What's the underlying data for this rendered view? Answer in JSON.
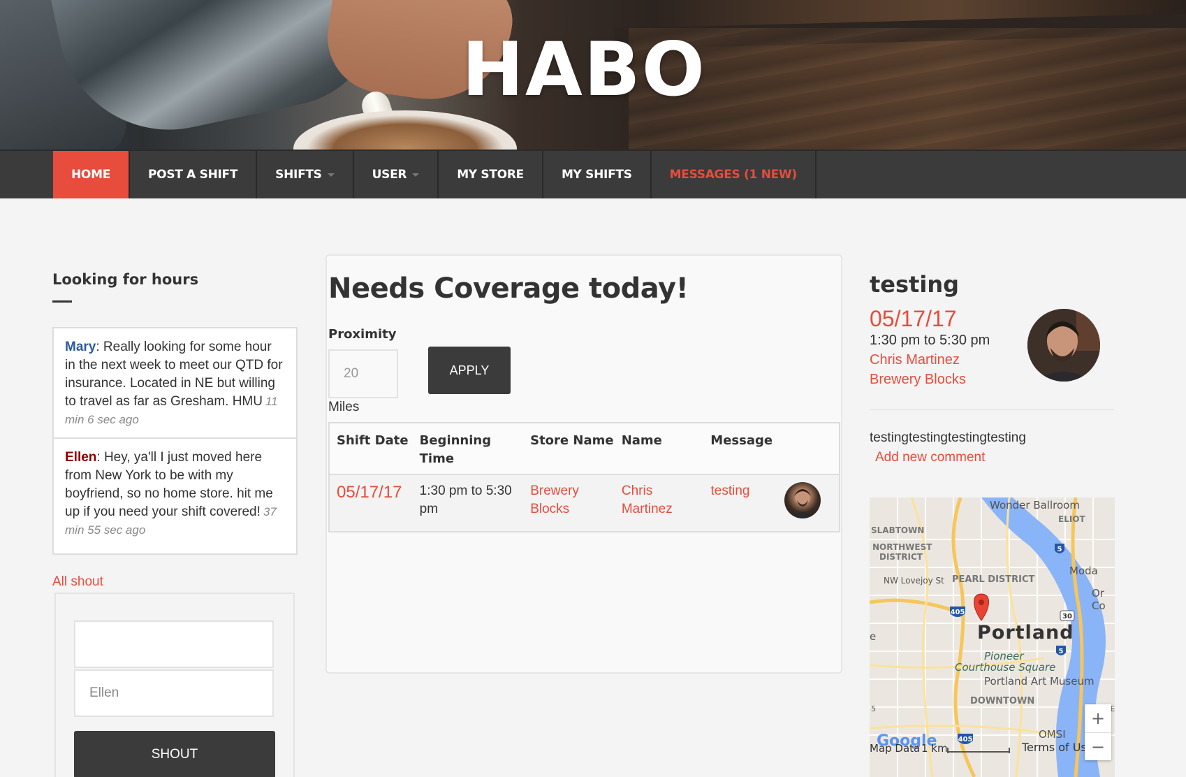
{
  "hero": {
    "title": "HABO"
  },
  "nav": {
    "items": [
      {
        "label": "HOME"
      },
      {
        "label": "POST A SHIFT"
      },
      {
        "label": "SHIFTS"
      },
      {
        "label": "USER"
      },
      {
        "label": "MY STORE"
      },
      {
        "label": "MY SHIFTS"
      },
      {
        "label": "MESSAGES (1 NEW)"
      }
    ]
  },
  "left": {
    "title": "Looking for hours",
    "shouts": [
      {
        "user": "Mary",
        "text": ": Really looking for some hour in the next week to meet our QTD for insurance. Located in NE but willing to travel as far as Gresham. HMU",
        "ago": "11 min 6 sec ago"
      },
      {
        "user": "Ellen",
        "text": ": Hey, ya'll I just moved here from New York to be with my boyfriend, so no home store. hit me up if you need your shift covered!",
        "ago": "37 min 55 sec ago"
      }
    ],
    "all_shout": "All shout",
    "form": {
      "name_value": "Ellen",
      "button": "SHOUT"
    }
  },
  "center": {
    "title": "Needs Coverage today!",
    "proximity_label": "Proximity",
    "proximity_placeholder": "20",
    "apply": "APPLY",
    "miles": "Miles",
    "columns": [
      "Shift Date",
      "Beginning Time",
      "Store Name",
      "Name",
      "Message"
    ],
    "rows": [
      {
        "date": "05/17/17",
        "time": "1:30 pm to 5:30 pm",
        "store": "Brewery Blocks",
        "name": "Chris Martinez",
        "message": "testing"
      }
    ]
  },
  "right": {
    "title": "testing",
    "date": "05/17/17",
    "time": "1:30 pm to 5:30 pm",
    "name": "Chris Martinez",
    "store": "Brewery Blocks",
    "comment": "testingtestingtestingtesting",
    "add_comment": "Add new comment"
  },
  "map": {
    "labels": {
      "wonder": "Wonder Ballroom",
      "eliot": "ELIOT",
      "slabtown": "SLABTOWN",
      "northwest": "NORTHWEST",
      "district": "DISTRICT",
      "lovejoy": "NW Lovejoy St",
      "pearl": "PEARL DISTRICT",
      "moda": "Moda",
      "portland": "Portland",
      "pioneer": "Pioneer",
      "courthouse": "Courthouse Square",
      "museum": "Portland Art Museum",
      "downtown": "DOWNTOWN",
      "omsi": "OMSI",
      "mapdata": "Map Data",
      "km": "1 km",
      "terms": "Terms of Use",
      "google": "Google",
      "or": "Or",
      "co": "Co",
      "e": "e",
      "five": "5",
      "ge": "GE"
    },
    "shields": [
      "405",
      "5",
      "30",
      "5",
      "405"
    ],
    "zoom_in": "+",
    "zoom_out": "−"
  }
}
